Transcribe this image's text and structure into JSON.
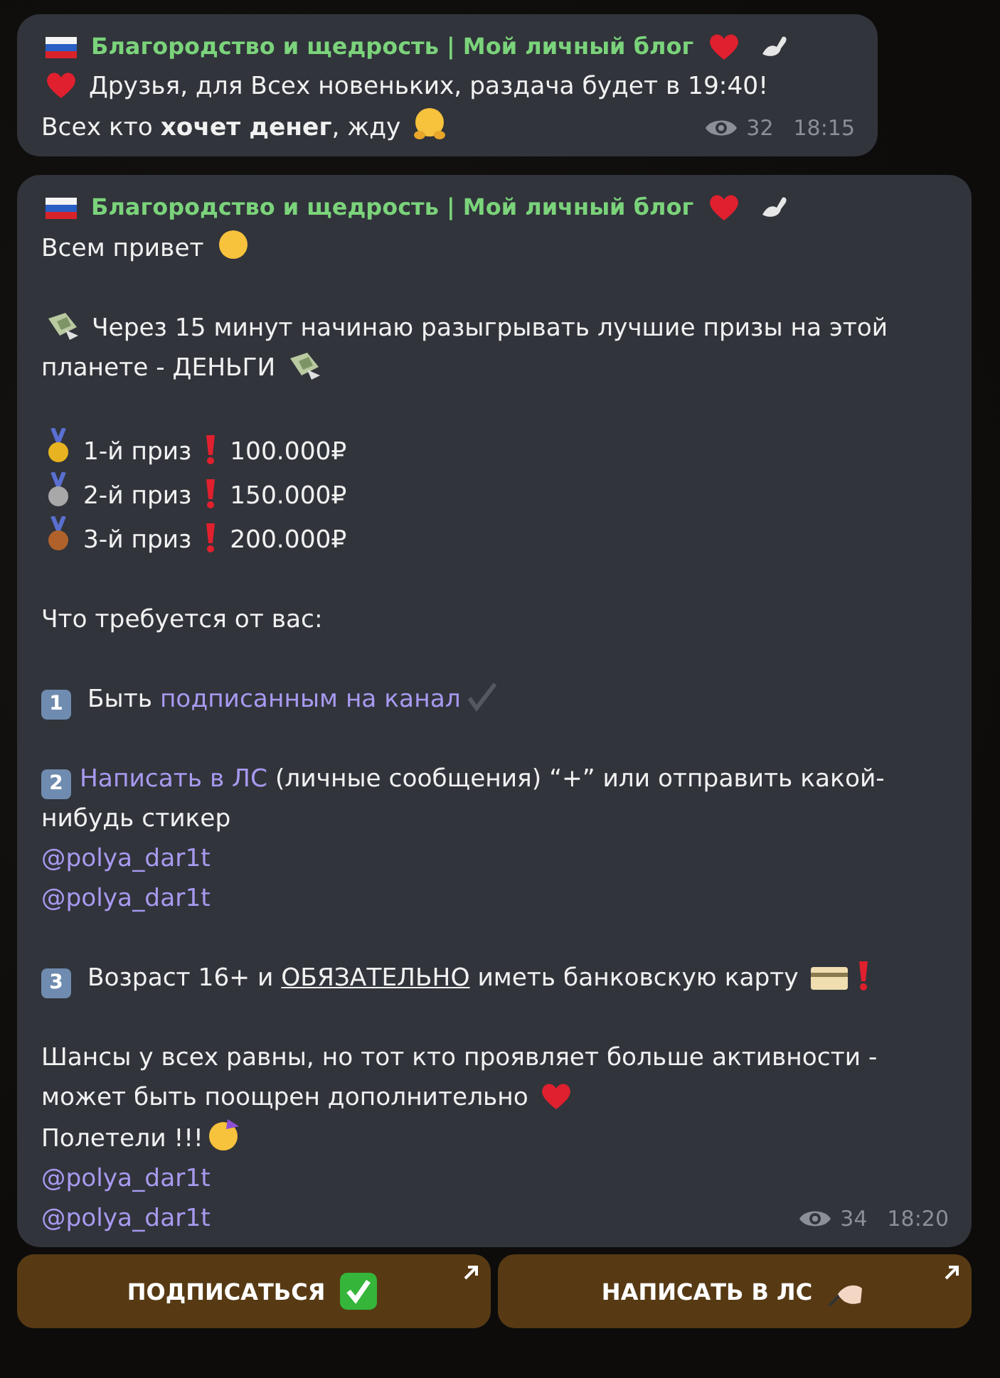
{
  "messages": [
    {
      "author": {
        "name": "Благородство и щедрость | Мой личный блог"
      },
      "blocks": [
        [
          [
            {
              "kind": "heart"
            },
            {
              "text": " Друзья, для Всех новеньких, раздача будет в 19:40!"
            }
          ],
          [
            {
              "text": "Всех кто "
            },
            {
              "kind": "bold",
              "text": "хочет денег"
            },
            {
              "text": ", жду "
            },
            {
              "kind": "hug"
            }
          ]
        ]
      ],
      "views": "32",
      "time": "18:15"
    },
    {
      "author": {
        "name": "Благородство и щедрость | Мой личный блог"
      },
      "blocks": [
        [
          [
            {
              "text": "Всем привет "
            },
            {
              "kind": "starstruck"
            }
          ]
        ],
        [
          [
            {
              "kind": "money"
            },
            {
              "text": " Через 15 минут начинаю разыгрывать лучшие призы на этой планете - ДЕНЬГИ "
            },
            {
              "kind": "money"
            }
          ]
        ],
        [
          [
            {
              "kind": "medal",
              "color": "#e8b320"
            },
            {
              "text": " 1-й приз  "
            },
            {
              "kind": "exclaim"
            },
            {
              "text": "  100.000₽"
            }
          ],
          [
            {
              "kind": "medal",
              "color": "#a8a8a8"
            },
            {
              "text": " 2-й приз  "
            },
            {
              "kind": "exclaim"
            },
            {
              "text": "  150.000₽"
            }
          ],
          [
            {
              "kind": "medal",
              "color": "#b0622a"
            },
            {
              "text": " 3-й приз  "
            },
            {
              "kind": "exclaim"
            },
            {
              "text": "  200.000₽"
            }
          ]
        ],
        [
          [
            {
              "text": "Что требуется от вас:"
            }
          ]
        ],
        [
          [
            {
              "kind": "keycap",
              "text": "1"
            },
            {
              "text": " Быть "
            },
            {
              "kind": "link",
              "text": "подписанным на канал"
            },
            {
              "kind": "check"
            }
          ]
        ],
        [
          [
            {
              "kind": "keycap",
              "text": "2"
            },
            {
              "kind": "link",
              "text": "Написать в ЛС"
            },
            {
              "text": " (личные сообщения) “+” или отправить какой-нибудь стикер"
            }
          ],
          [
            {
              "kind": "link",
              "text": "@polya_dar1t"
            }
          ],
          [
            {
              "kind": "link",
              "text": "@polya_dar1t"
            }
          ]
        ],
        [
          [
            {
              "kind": "keycap",
              "text": "3"
            },
            {
              "text": " Возраст 16+ и "
            },
            {
              "kind": "underline",
              "text": "ОБЯЗАТЕЛЬНО"
            },
            {
              "text": " иметь банковскую карту "
            },
            {
              "kind": "card"
            },
            {
              "kind": "exclaim"
            }
          ]
        ],
        [
          [
            {
              "text": "Шансы у всех равны, но тот кто проявляет больше активности - может быть поощрен дополнительно "
            },
            {
              "kind": "heart"
            }
          ],
          [
            {
              "text": "Полетели !!!"
            },
            {
              "kind": "party"
            }
          ],
          [
            {
              "kind": "link",
              "text": "@polya_dar1t"
            }
          ],
          [
            {
              "kind": "link",
              "text": "@polya_dar1t"
            }
          ]
        ]
      ],
      "views": "34",
      "time": "18:20",
      "buttons": [
        {
          "label": "ПОДПИСАТЬСЯ"
        },
        {
          "label": "НАПИСАТЬ В ЛС"
        }
      ]
    }
  ]
}
